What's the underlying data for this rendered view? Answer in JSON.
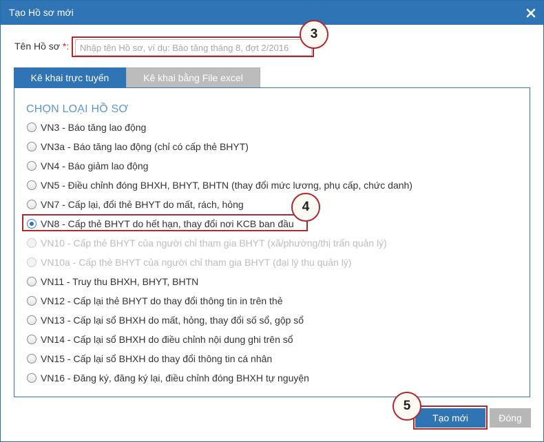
{
  "dialog": {
    "title": "Tạo Hồ sơ mới",
    "close_icon": "close-icon"
  },
  "name_field": {
    "label": "Tên Hồ sơ",
    "required_mark": "*:",
    "placeholder": "Nhập tên Hồ sơ, ví dụ: Báo tăng tháng 8, đợt 2/2016",
    "value": ""
  },
  "tabs": [
    {
      "label": "Kê khai trực tuyến",
      "active": true
    },
    {
      "label": "Kê khai bằng File excel",
      "active": false
    }
  ],
  "section": {
    "title": "CHỌN LOẠI HỒ SƠ"
  },
  "options": [
    {
      "label": "VN3 - Báo tăng lao động",
      "checked": false,
      "disabled": false
    },
    {
      "label": "VN3a - Báo tăng lao động (chỉ có cấp thẻ BHYT)",
      "checked": false,
      "disabled": false
    },
    {
      "label": "VN4 - Báo giảm lao động",
      "checked": false,
      "disabled": false
    },
    {
      "label": "VN5 - Điều chỉnh đóng BHXH, BHYT, BHTN (thay đổi mức lương, phụ cấp, chức danh)",
      "checked": false,
      "disabled": false
    },
    {
      "label": "VN7 - Cấp lại, đổi thẻ BHYT do mất, rách, hỏng",
      "checked": false,
      "disabled": false
    },
    {
      "label": "VN8 - Cấp thẻ BHYT do hết hạn, thay đổi nơi KCB ban đầu",
      "checked": true,
      "disabled": false
    },
    {
      "label": "VN10 - Cấp thẻ BHYT của người chỉ tham gia BHYT (xã/phường/thị trấn quản lý)",
      "checked": false,
      "disabled": true
    },
    {
      "label": "VN10a - Cấp thẻ BHYT của người chỉ tham gia BHYT (đại lý thu quản lý)",
      "checked": false,
      "disabled": true
    },
    {
      "label": "VN11 - Truy thu BHXH, BHYT, BHTN",
      "checked": false,
      "disabled": false
    },
    {
      "label": "VN12 - Cấp lại thẻ BHYT do thay đổi thông tin in trên thẻ",
      "checked": false,
      "disabled": false
    },
    {
      "label": "VN13 - Cấp lại sổ BHXH do mất, hỏng, thay đổi số sổ, gộp sổ",
      "checked": false,
      "disabled": false
    },
    {
      "label": "VN14 - Cấp lại sổ BHXH do điều chỉnh nội dung ghi trên sổ",
      "checked": false,
      "disabled": false
    },
    {
      "label": "VN15 - Cấp lại sổ BHXH do thay đổi thông tin cá nhân",
      "checked": false,
      "disabled": false
    },
    {
      "label": "VN16 - Đăng ký, đăng ký lại, điều chỉnh đóng BHXH tự nguyện",
      "checked": false,
      "disabled": false
    }
  ],
  "buttons": {
    "create": "Tạo mới",
    "close": "Đóng"
  },
  "callouts": {
    "step3": "3",
    "step4": "4",
    "step5": "5"
  },
  "colors": {
    "primary": "#2f74b5",
    "highlight": "#b0282b",
    "section_title": "#5c97d0",
    "disabled": "#bdbdbd"
  }
}
